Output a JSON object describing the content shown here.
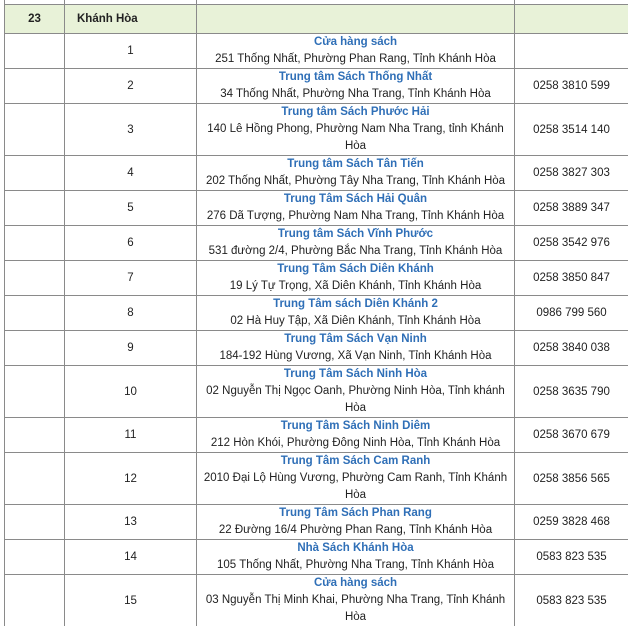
{
  "region": {
    "number": "23",
    "name": "Khánh Hòa"
  },
  "stores": [
    {
      "no": "1",
      "name": "Cửa hàng sách",
      "address": "251 Thống Nhất, Phường Phan Rang, Tỉnh Khánh Hòa",
      "phone": ""
    },
    {
      "no": "2",
      "name": "Trung tâm Sách Thống Nhất",
      "address": "34 Thống Nhất, Phường Nha Trang, Tỉnh Khánh Hòa",
      "phone": "0258 3810 599"
    },
    {
      "no": "3",
      "name": "Trung tâm Sách Phước Hải",
      "address": "140 Lê Hồng Phong, Phường Nam Nha Trang, tỉnh Khánh Hòa",
      "phone": "0258 3514 140"
    },
    {
      "no": "4",
      "name": "Trung tâm Sách Tân Tiến",
      "address": "202 Thống Nhất, Phường Tây Nha Trang, Tỉnh Khánh Hòa",
      "phone": "0258 3827 303"
    },
    {
      "no": "5",
      "name": "Trung Tâm Sách Hải Quân",
      "address": "276 Dã Tượng, Phường Nam Nha Trang, Tỉnh Khánh Hòa",
      "phone": "0258 3889 347"
    },
    {
      "no": "6",
      "name": "Trung tâm Sách Vĩnh Phước",
      "address": "531 đường 2/4, Phường Bắc Nha Trang, Tỉnh Khánh Hòa",
      "phone": "0258 3542 976"
    },
    {
      "no": "7",
      "name": "Trung Tâm Sách Diên Khánh",
      "address": "19 Lý Tự Trọng, Xã Diên Khánh, Tỉnh Khánh Hòa",
      "phone": "0258 3850 847"
    },
    {
      "no": "8",
      "name": "Trung Tâm sách Diên Khánh 2",
      "address": "02 Hà Huy Tập, Xã Diên Khánh, Tỉnh Khánh Hòa",
      "phone": "0986 799 560"
    },
    {
      "no": "9",
      "name": "Trung Tâm Sách Vạn Ninh",
      "address": "184-192 Hùng Vương, Xã Vạn Ninh, Tỉnh Khánh Hòa",
      "phone": "0258 3840 038"
    },
    {
      "no": "10",
      "name": "Trung Tâm Sách Ninh Hòa",
      "address": "02 Nguyễn Thị Ngọc Oanh, Phường Ninh Hòa, Tỉnh khánh Hòa",
      "phone": "0258 3635 790"
    },
    {
      "no": "11",
      "name": "Trung Tâm Sách Ninh Diêm",
      "address": "212 Hòn Khói, Phường Đông Ninh Hòa, Tỉnh Khánh Hòa",
      "phone": "0258 3670 679"
    },
    {
      "no": "12",
      "name": "Trung Tâm Sách Cam Ranh",
      "address": "2010 Đại Lộ Hùng Vương, Phường Cam Ranh, Tỉnh Khánh Hòa",
      "phone": "0258 3856 565"
    },
    {
      "no": "13",
      "name": "Trung Tâm Sách Phan Rang",
      "address": "22 Đường 16/4 Phường Phan Rang, Tỉnh Khánh Hòa",
      "phone": "0259 3828 468"
    },
    {
      "no": "14",
      "name": "Nhà Sách Khánh Hòa",
      "address": "105 Thống Nhất, Phường Nha Trang, Tỉnh Khánh Hòa",
      "phone": "0583 823 535"
    },
    {
      "no": "15",
      "name": "Cửa hàng sách",
      "address": "03 Nguyễn Thị Minh Khai, Phường Nha Trang, Tỉnh Khánh Hòa",
      "phone": "0583 823 535"
    }
  ]
}
